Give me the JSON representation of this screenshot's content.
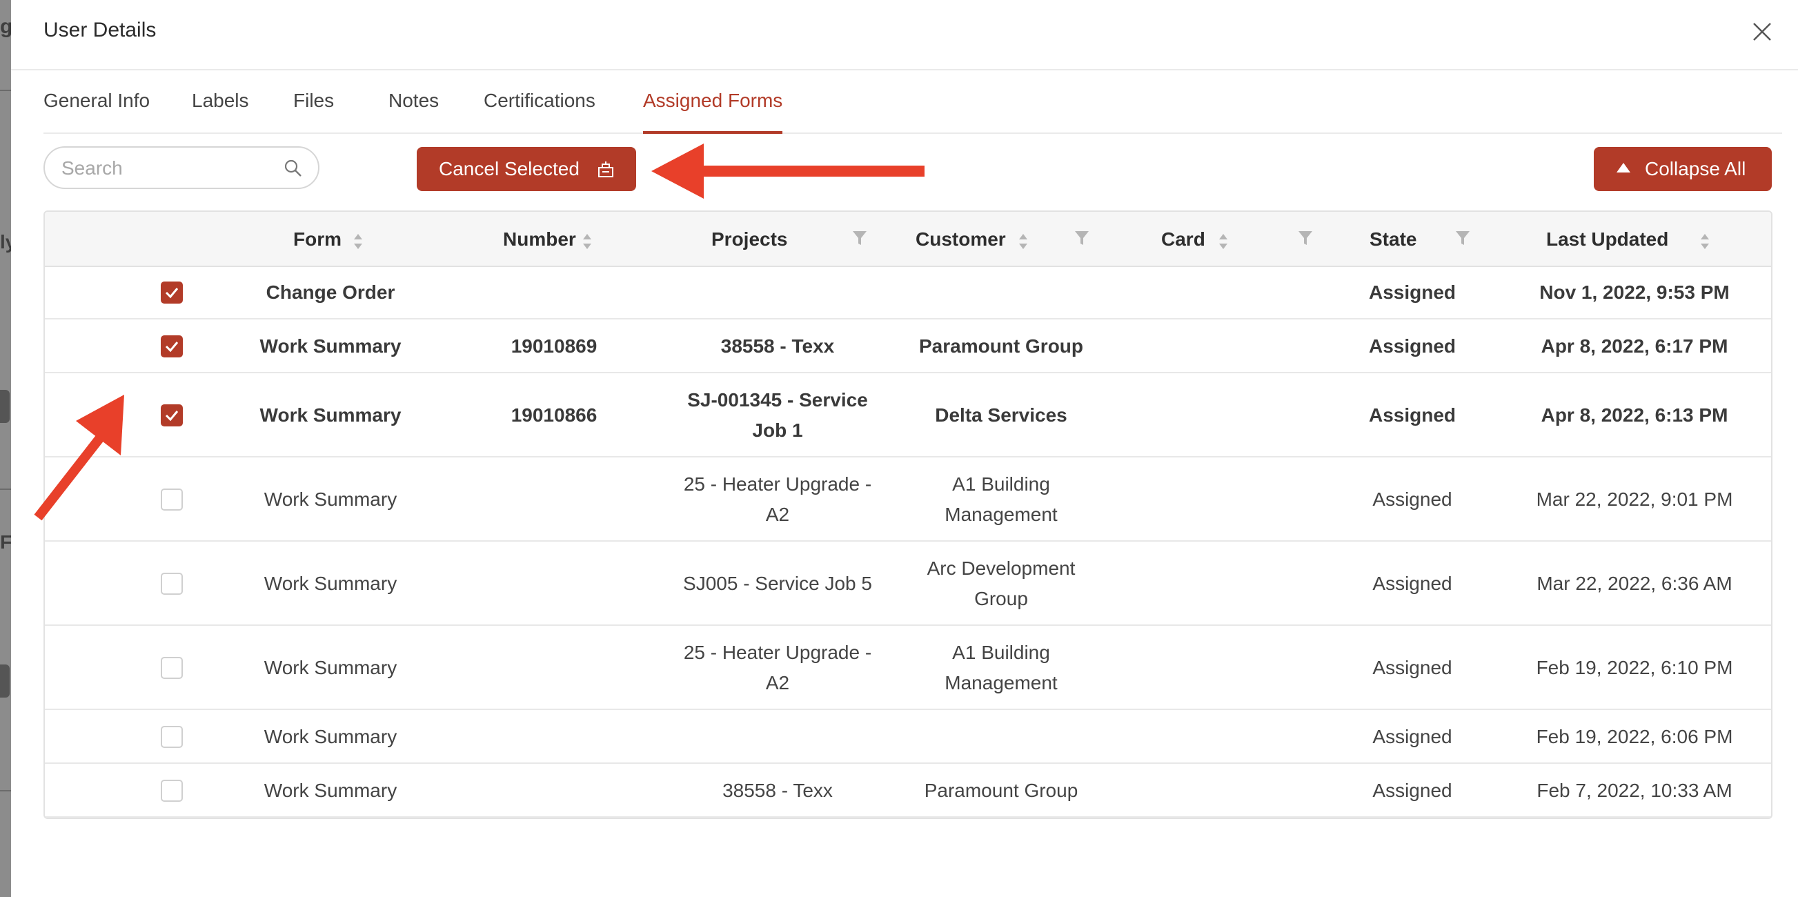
{
  "modal": {
    "title": "User Details"
  },
  "tabs": [
    {
      "label": "General Info"
    },
    {
      "label": "Labels"
    },
    {
      "label": "Files"
    },
    {
      "label": "Notes"
    },
    {
      "label": "Certifications"
    },
    {
      "label": "Assigned Forms",
      "active": true
    }
  ],
  "search": {
    "placeholder": "Search"
  },
  "toolbar": {
    "cancel_label": "Cancel Selected",
    "collapse_label": "Collapse All"
  },
  "table": {
    "columns": [
      "Form",
      "Number",
      "Projects",
      "Customer",
      "Card",
      "State",
      "Last Updated"
    ],
    "rows": [
      {
        "checked": true,
        "form": "Change Order",
        "number": "",
        "project": "",
        "customer": "",
        "card": "",
        "state": "Assigned",
        "updated": "Nov 1, 2022, 9:53 PM"
      },
      {
        "checked": true,
        "form": "Work Summary",
        "number": "19010869",
        "project": "38558 - Texx",
        "customer": "Paramount Group",
        "card": "",
        "state": "Assigned",
        "updated": "Apr 8, 2022, 6:17 PM"
      },
      {
        "checked": true,
        "form": "Work Summary",
        "number": "19010866",
        "project": "SJ-001345 - Service Job 1",
        "customer": "Delta Services",
        "card": "",
        "state": "Assigned",
        "updated": "Apr 8, 2022, 6:13 PM"
      },
      {
        "checked": false,
        "form": "Work Summary",
        "number": "",
        "project": "25 - Heater Upgrade - A2",
        "customer": "A1 Building Management",
        "card": "",
        "state": "Assigned",
        "updated": "Mar 22, 2022, 9:01 PM"
      },
      {
        "checked": false,
        "form": "Work Summary",
        "number": "",
        "project": "SJ005 - Service Job 5",
        "customer": "Arc Development Group",
        "card": "",
        "state": "Assigned",
        "updated": "Mar 22, 2022, 6:36 AM"
      },
      {
        "checked": false,
        "form": "Work Summary",
        "number": "",
        "project": "25 - Heater Upgrade - A2",
        "customer": "A1 Building Management",
        "card": "",
        "state": "Assigned",
        "updated": "Feb 19, 2022, 6:10 PM"
      },
      {
        "checked": false,
        "form": "Work Summary",
        "number": "",
        "project": "",
        "customer": "",
        "card": "",
        "state": "Assigned",
        "updated": "Feb 19, 2022, 6:06 PM"
      },
      {
        "checked": false,
        "form": "Work Summary",
        "number": "",
        "project": "38558 - Texx",
        "customer": "Paramount Group",
        "card": "",
        "state": "Assigned",
        "updated": "Feb 7, 2022, 10:33 AM"
      }
    ]
  },
  "background_fragments": [
    "g",
    "ly",
    "Fu"
  ],
  "colors": {
    "accent": "#b23b28",
    "annotation_arrow": "#e8402a"
  },
  "icons": [
    "close-icon",
    "search-icon",
    "cancel-icon",
    "caret-up-icon",
    "sort-icon",
    "filter-icon"
  ]
}
